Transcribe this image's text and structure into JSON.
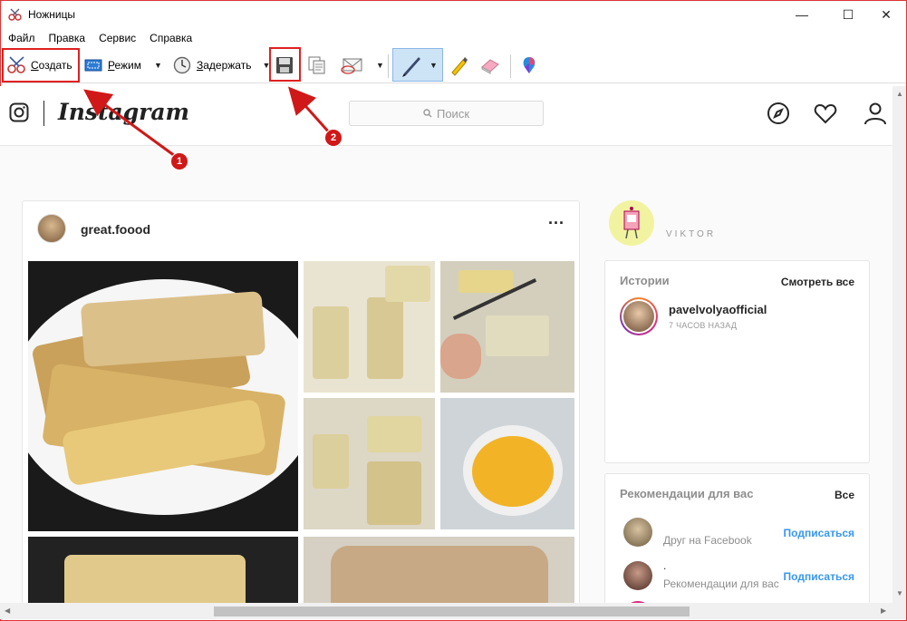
{
  "window": {
    "title": "Ножницы",
    "controls": {
      "minimize": "—",
      "maximize": "☐",
      "close": "✕"
    }
  },
  "menubar": {
    "items": [
      "Файл",
      "Правка",
      "Сервис",
      "Справка"
    ]
  },
  "toolbar": {
    "new_label_underlined": "С",
    "new_label_rest": "оздать",
    "mode_label_underlined": "Р",
    "mode_label_rest": "ежим",
    "delay_label_underlined": "З",
    "delay_label_rest": "адержать",
    "icons": [
      "scissors-icon",
      "mode-icon",
      "clock-icon",
      "save-icon",
      "copy-icon",
      "send-icon",
      "pen-icon",
      "highlighter-icon",
      "eraser-icon",
      "paint3d-icon"
    ]
  },
  "annotations": {
    "badge1": "1",
    "badge2": "2",
    "color": "#e02020"
  },
  "instagram": {
    "wordmark": "Instagram",
    "search_placeholder": "Поиск",
    "post": {
      "username": "great.foood",
      "more": "···"
    },
    "profile": {
      "name": "VIKTOR"
    },
    "stories": {
      "title": "Истории",
      "link": "Смотреть все",
      "user": "pavelvolyaofficial",
      "time": "7 ЧАСОВ НАЗАД"
    },
    "recommendations": {
      "title": "Рекомендации для вас",
      "link": "Все",
      "items": [
        {
          "name": "",
          "sub": "Друг на Facebook",
          "action": "Подписаться"
        },
        {
          "name": ".",
          "sub": "Рекомендации для вас",
          "action": "Подписаться"
        }
      ]
    },
    "colors": {
      "link": "#3897f0",
      "border": "#e6e6e6"
    }
  }
}
